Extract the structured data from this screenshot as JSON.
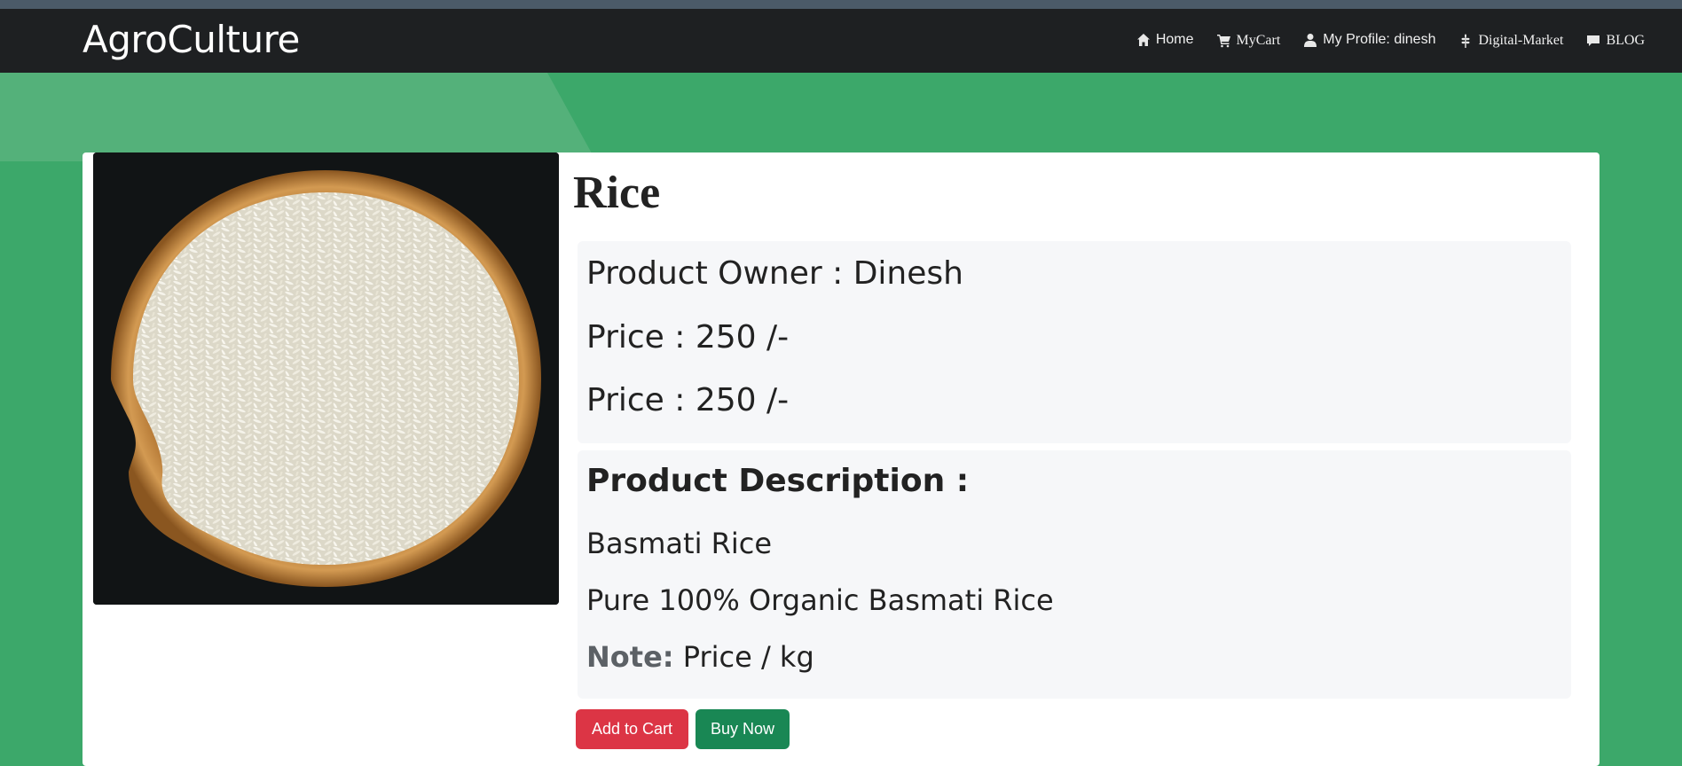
{
  "brand": "AgroCulture",
  "nav": {
    "home": "Home",
    "cart": "MyCart",
    "profile": "My Profile: dinesh",
    "market": "Digital-Market",
    "blog": "BLOG"
  },
  "product": {
    "name": "Rice",
    "owner_line": "Product Owner : Dinesh",
    "price_line_1": "Price : 250 /-",
    "price_line_2": "Price : 250 /-",
    "description_heading": "Product Description :",
    "description_line_1": "Basmati Rice",
    "description_line_2": "Pure 100% Organic Basmati Rice",
    "note_label": "Note:",
    "note_text": " Price / kg"
  },
  "buttons": {
    "add_to_cart": "Add to Cart",
    "buy_now": "Buy Now"
  },
  "colors": {
    "navbar": "#1e2022",
    "banner": "#3ca86a",
    "add_to_cart": "#dc3545",
    "buy_now": "#198754"
  },
  "icons": [
    "home-icon",
    "cart-icon",
    "user-icon",
    "plant-icon",
    "comment-icon"
  ]
}
